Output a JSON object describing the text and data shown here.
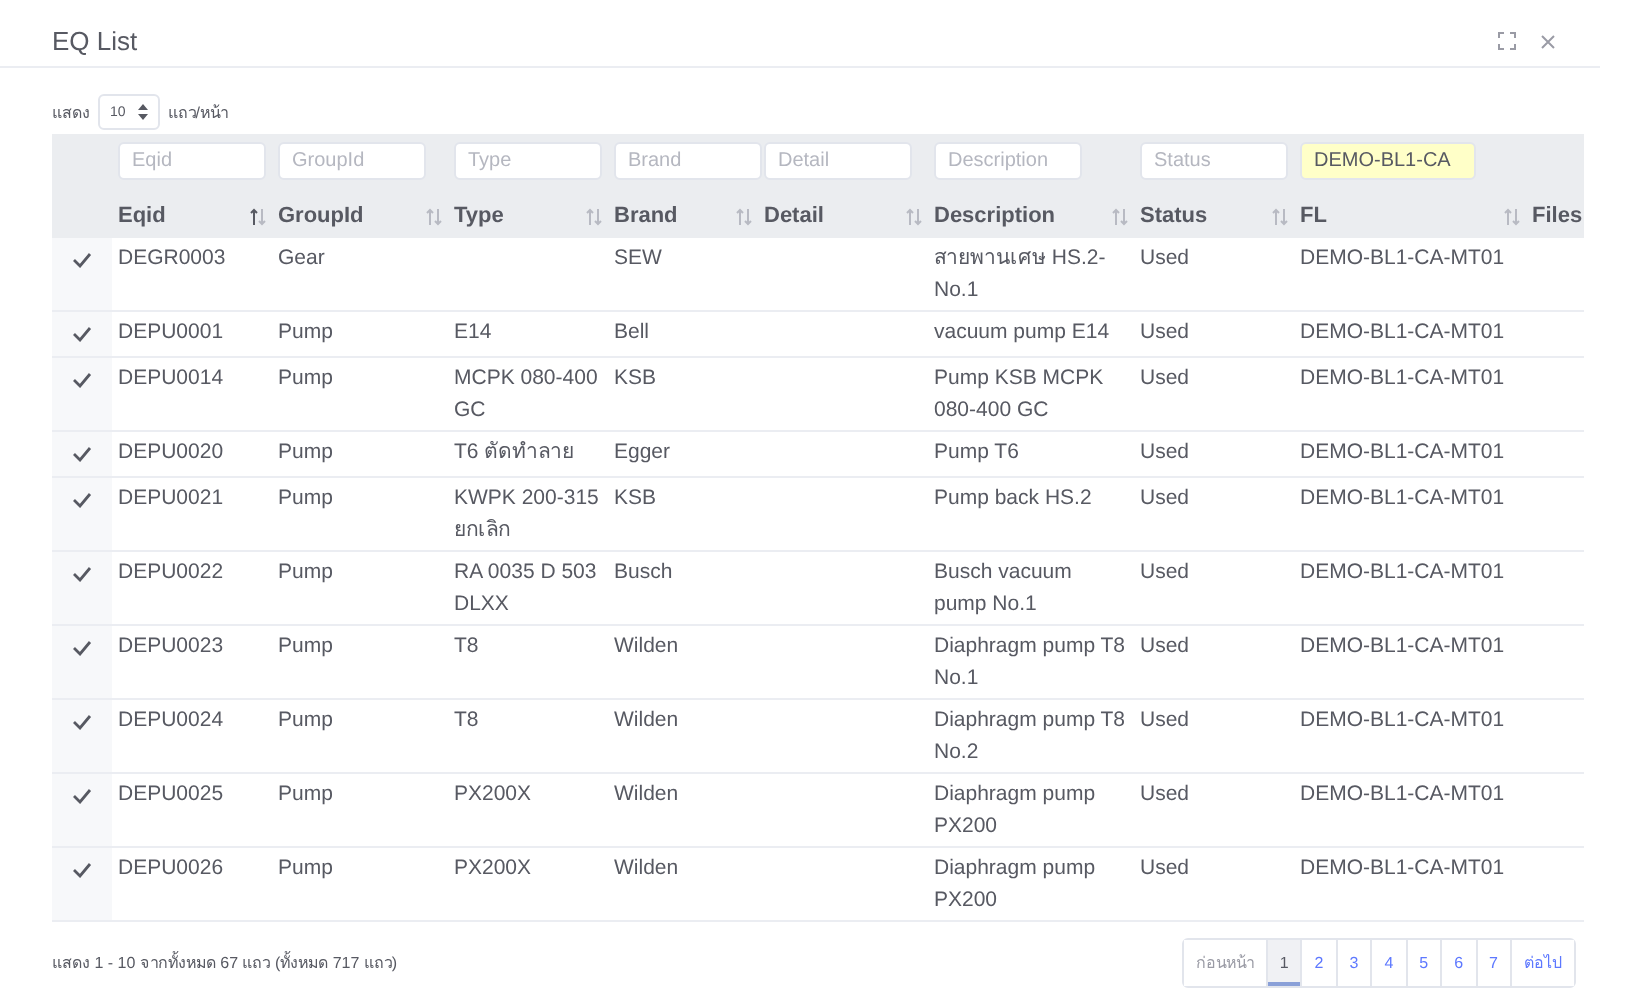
{
  "window": {
    "title": "EQ List"
  },
  "page_size": {
    "label_before": "แสดง",
    "value": "10",
    "label_after": "แถว/หน้า"
  },
  "table": {
    "columns": [
      {
        "label": "Eqid",
        "filter_placeholder": "Eqid",
        "sorted": true
      },
      {
        "label": "GroupId",
        "filter_placeholder": "GroupId",
        "sorted": false
      },
      {
        "label": "Type",
        "filter_placeholder": "Type",
        "sorted": false
      },
      {
        "label": "Brand",
        "filter_placeholder": "Brand",
        "sorted": false
      },
      {
        "label": "Detail",
        "filter_placeholder": "Detail",
        "sorted": false
      },
      {
        "label": "Description",
        "filter_placeholder": "Description",
        "sorted": false
      },
      {
        "label": "Status",
        "filter_placeholder": "Status",
        "sorted": false
      },
      {
        "label": "FL",
        "filter_value": "DEMO-BL1-CA",
        "sorted": false
      },
      {
        "label": "Files"
      }
    ],
    "rows": [
      {
        "checked": true,
        "cells": [
          "DEGR0003",
          "Gear",
          "",
          "SEW",
          "",
          "สายพานเศษ HS.2-No.1",
          "Used",
          "DEMO-BL1-CA-MT01",
          ""
        ]
      },
      {
        "checked": true,
        "cells": [
          "DEPU0001",
          "Pump",
          "E14",
          "Bell",
          "",
          "vacuum pump E14",
          "Used",
          "DEMO-BL1-CA-MT01",
          ""
        ]
      },
      {
        "checked": true,
        "cells": [
          "DEPU0014",
          "Pump",
          "MCPK 080-400 GC",
          "KSB",
          "",
          "Pump KSB MCPK 080-400 GC",
          "Used",
          "DEMO-BL1-CA-MT01",
          ""
        ]
      },
      {
        "checked": true,
        "cells": [
          "DEPU0020",
          "Pump",
          "T6 ตัดทำลาย",
          "Egger",
          "",
          "Pump T6",
          "Used",
          "DEMO-BL1-CA-MT01",
          ""
        ]
      },
      {
        "checked": true,
        "cells": [
          "DEPU0021",
          "Pump",
          "KWPK 200-315 ยกเลิก",
          "KSB",
          "",
          "Pump back HS.2",
          "Used",
          "DEMO-BL1-CA-MT01",
          ""
        ]
      },
      {
        "checked": true,
        "cells": [
          "DEPU0022",
          "Pump",
          "RA 0035 D 503 DLXX",
          "Busch",
          "",
          "Busch vacuum pump No.1",
          "Used",
          "DEMO-BL1-CA-MT01",
          ""
        ]
      },
      {
        "checked": true,
        "cells": [
          "DEPU0023",
          "Pump",
          "T8",
          "Wilden",
          "",
          "Diaphragm pump T8 No.1",
          "Used",
          "DEMO-BL1-CA-MT01",
          ""
        ]
      },
      {
        "checked": true,
        "cells": [
          "DEPU0024",
          "Pump",
          "T8",
          "Wilden",
          "",
          "Diaphragm pump T8 No.2",
          "Used",
          "DEMO-BL1-CA-MT01",
          ""
        ]
      },
      {
        "checked": true,
        "cells": [
          "DEPU0025",
          "Pump",
          "PX200X",
          "Wilden",
          "",
          "Diaphragm pump PX200",
          "Used",
          "DEMO-BL1-CA-MT01",
          ""
        ]
      },
      {
        "checked": true,
        "cells": [
          "DEPU0026",
          "Pump",
          "PX200X",
          "Wilden",
          "",
          "Diaphragm pump PX200",
          "Used",
          "DEMO-BL1-CA-MT01",
          ""
        ]
      }
    ]
  },
  "summary": "แสดง 1 - 10 จากทั้งหมด 67 แถว (ทั้งหมด 717 แถว)",
  "pagination": [
    {
      "label": "ก่อนหน้า",
      "selected": false,
      "disabled": true
    },
    {
      "label": "1",
      "selected": true,
      "disabled": false
    },
    {
      "label": "2",
      "selected": false,
      "disabled": false
    },
    {
      "label": "3",
      "selected": false,
      "disabled": false
    },
    {
      "label": "4",
      "selected": false,
      "disabled": false
    },
    {
      "label": "5",
      "selected": false,
      "disabled": false
    },
    {
      "label": "6",
      "selected": false,
      "disabled": false
    },
    {
      "label": "7",
      "selected": false,
      "disabled": false
    },
    {
      "label": "ต่อไป",
      "selected": false,
      "disabled": false
    }
  ]
}
